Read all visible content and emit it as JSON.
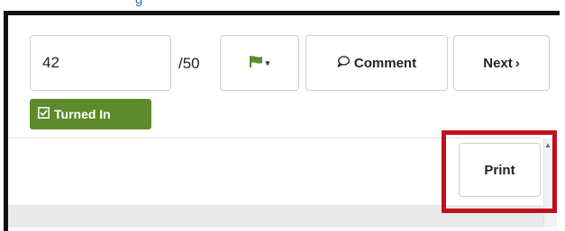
{
  "header": {
    "top_link_fragment": "g"
  },
  "grading": {
    "score_value": "42",
    "out_of": "/50",
    "comment_label": "Comment",
    "next_label": "Next",
    "next_chevron": "›",
    "flag_caret": "▾",
    "status_label": "Turned In"
  },
  "toolbar": {
    "print_label": "Print"
  },
  "colors": {
    "status_badge": "#5d8a2a",
    "flag": "#5d8a2a",
    "highlight": "#c0101c",
    "frame": "#111111"
  },
  "icons": {
    "flag": "flag-icon",
    "comment": "speech-bubble-icon",
    "status": "checkbox-icon",
    "caret": "caret-down-icon",
    "next": "chevron-right-icon"
  }
}
